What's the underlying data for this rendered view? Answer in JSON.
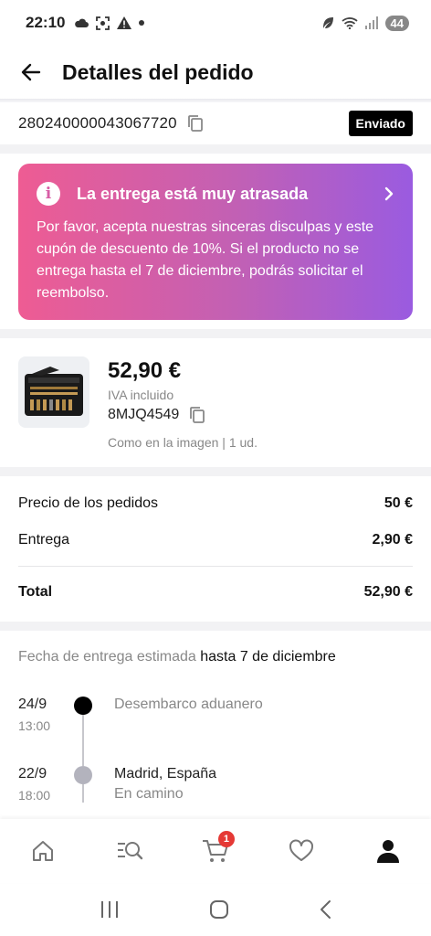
{
  "status_bar": {
    "time": "22:10",
    "left_icons": [
      "cloud-icon",
      "screenshot-icon",
      "warning-icon",
      "dot-icon"
    ],
    "right_icons": [
      "leaf-icon",
      "wifi-icon",
      "signal-icon"
    ],
    "battery": "44"
  },
  "header": {
    "title": "Detalles del pedido",
    "back_icon": "back-arrow-icon"
  },
  "order": {
    "number": "280240000043067720",
    "status": "Enviado"
  },
  "delay_notice": {
    "title": "La entrega está muy atrasada",
    "body": "Por favor, acepta nuestras sinceras disculpas y este cupón de descuento de 10%. Si el producto no se entrega hasta el 7 de diciembre, podrás solicitar el reembolso.",
    "colors": {
      "start": "#ee5c93",
      "end": "#9a5be0"
    }
  },
  "product": {
    "price": "52,90 €",
    "vat": "IVA incluido",
    "sku": "8MJQ4549",
    "variant": "Como en la imagen | 1 ud."
  },
  "summary": {
    "rows": [
      {
        "label": "Precio de los pedidos",
        "value": "50 €"
      },
      {
        "label": "Entrega",
        "value": "2,90 €"
      }
    ],
    "total_label": "Total",
    "total_value": "52,90 €"
  },
  "delivery": {
    "estimate_label": "Fecha de entrega estimada",
    "estimate_value": "hasta 7 de diciembre",
    "events": [
      {
        "date": "24/9",
        "time": "13:00",
        "location": "Desembarco aduanero",
        "status": "",
        "dot_color": "#000000"
      },
      {
        "date": "22/9",
        "time": "18:00",
        "location": "Madrid, España",
        "status": "En camino",
        "dot_color": "#b3b3bd"
      }
    ]
  },
  "bottom_nav": {
    "items": [
      "home-icon",
      "search-list-icon",
      "cart-icon",
      "heart-icon",
      "account-icon"
    ],
    "cart_count": "1",
    "active": "account-icon"
  }
}
